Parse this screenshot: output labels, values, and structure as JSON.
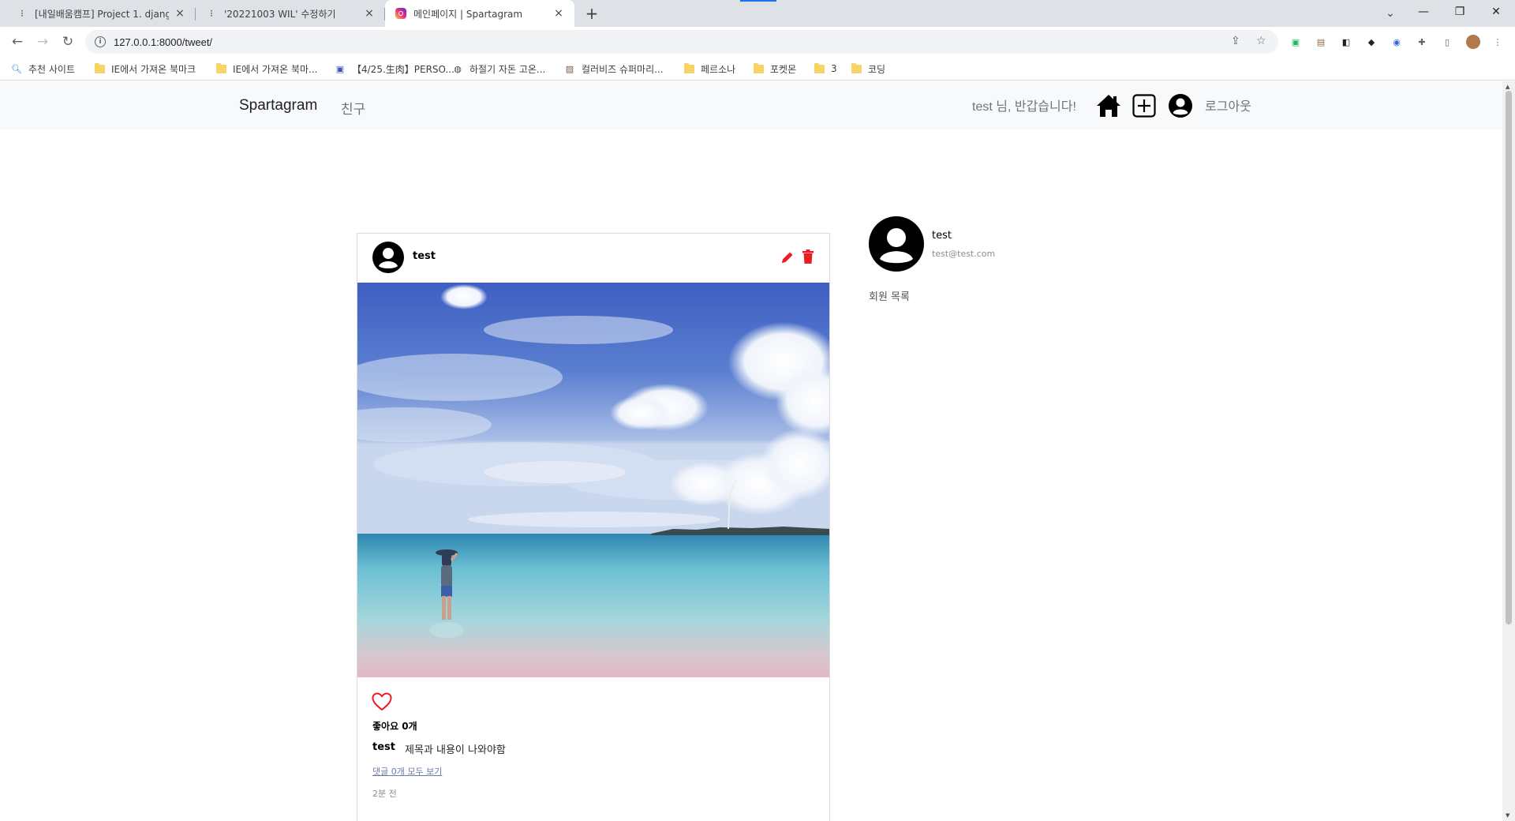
{
  "browser": {
    "tabs": [
      {
        "title": "[내일배움캠프] Project 1. django",
        "icon": "notion-icon"
      },
      {
        "title": "'20221003 WIL' 수정하기",
        "icon": "notion-icon"
      },
      {
        "title": "메인페이지 | Spartagram",
        "icon": "instagram-icon"
      }
    ],
    "new_tab": "+",
    "url": "127.0.0.1:8000/tweet/",
    "bookmarks": [
      {
        "label": "추천 사이트",
        "icon": "search-icon"
      },
      {
        "label": "IE에서 가져온 북마크",
        "icon": "folder-icon"
      },
      {
        "label": "IE에서 가져온 북마...",
        "icon": "folder-icon"
      },
      {
        "label": "【4/25.生肉】PERSO...",
        "icon": "calendar-icon"
      },
      {
        "label": "하절기 자돈 고온...",
        "icon": "globe-icon"
      },
      {
        "label": "컬러비즈 슈퍼마리...",
        "icon": "image-icon"
      },
      {
        "label": "페르소나",
        "icon": "folder-icon"
      },
      {
        "label": "포켓몬",
        "icon": "folder-icon"
      },
      {
        "label": "3",
        "icon": "folder-icon"
      },
      {
        "label": "코딩",
        "icon": "folder-icon"
      }
    ]
  },
  "site": {
    "brand": "Spartagram",
    "nav_friends": "친구",
    "greeting": "test 님, 반갑습니다!",
    "logout": "로그아웃",
    "icons": [
      "home-icon",
      "add-post-icon",
      "profile-icon"
    ]
  },
  "post": {
    "author": "test",
    "likes": "좋아요 0개",
    "caption_author": "test",
    "caption": "제목과 내용이 나와야함",
    "comments_link": "댓글 0개 모두 보기",
    "time": "2분 전",
    "colors": {
      "accent": "#ed1c24"
    }
  },
  "sidebar": {
    "name": "test",
    "email": "test@test.com",
    "members_title": "회원 목록"
  }
}
